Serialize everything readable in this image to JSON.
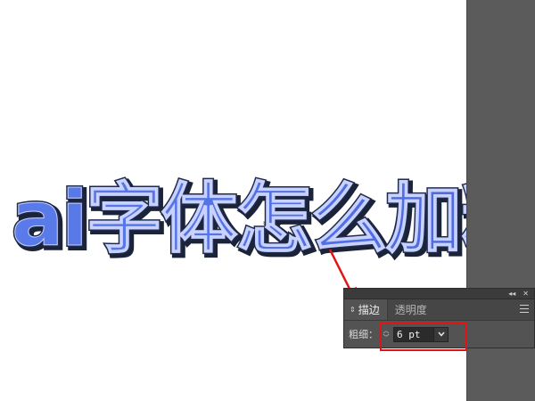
{
  "canvas": {
    "headline": "ai字体怎么加粗",
    "fill_color": "#4a6ee0",
    "stroke_color": "#1f2a4a",
    "annotation_color": "#e01414"
  },
  "panel": {
    "topbar_icons": [
      "collapse-icon",
      "close-icon"
    ],
    "tabs": [
      {
        "label": "描边",
        "active": true
      },
      {
        "label": "透明度",
        "active": false
      }
    ],
    "weight_label": "粗细：",
    "weight_value": "6 pt",
    "menu_icon": "panel-menu-icon"
  }
}
